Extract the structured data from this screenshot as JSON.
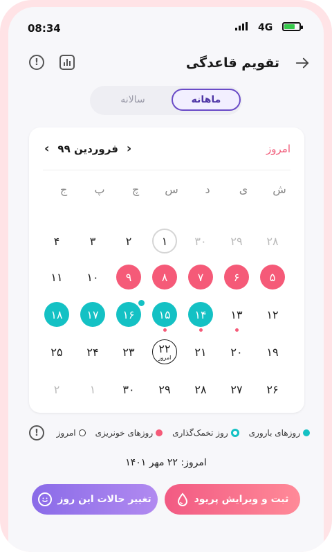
{
  "status_bar": {
    "time": "08:34",
    "network": "4G"
  },
  "header": {
    "title": "تقویم قاعدگی"
  },
  "tabs": {
    "monthly": "ماهانه",
    "yearly": "سالانه",
    "selected": "monthly"
  },
  "calendar": {
    "today_link": "امروز",
    "month_label": "فروردین ۹۹",
    "weekdays": [
      "ش",
      "ی",
      "د",
      "س",
      "چ",
      "پ",
      "ج"
    ],
    "weeks": [
      [
        "۲۸",
        "۲۹",
        "۳۰",
        "۱",
        "۲",
        "۳",
        "۴"
      ],
      [
        "۵",
        "۶",
        "۷",
        "۸",
        "۹",
        "۱۰",
        "۱۱"
      ],
      [
        "۱۲",
        "۱۳",
        "۱۴",
        "۱۵",
        "۱۶",
        "۱۷",
        "۱۸"
      ],
      [
        "۱۹",
        "۲۰",
        "۲۱",
        "۲۲",
        "۲۳",
        "۲۴",
        "۲۵"
      ],
      [
        "۲۶",
        "۲۷",
        "۲۸",
        "۲۹",
        "۳۰",
        "۱",
        "۲"
      ]
    ],
    "today_small_label": "امروز"
  },
  "legend": {
    "fertile": "روزهای باروری",
    "ovulation": "روز تخمک‌گذاری",
    "period": "روزهای خونریزی",
    "today": "امروز"
  },
  "today_text": "امروز: ۲۲ مهر ۱۴۰۱",
  "buttons": {
    "period": "ثبت و ویرایش پریود",
    "mood": "تغییر حالات این روز"
  },
  "colors": {
    "period": "#f55a78",
    "fertile": "#14c1c4",
    "accent": "#6a4bc7"
  },
  "icons": [
    "info-icon",
    "stats-icon",
    "back-arrow-icon",
    "chevron-left-icon",
    "chevron-right-icon",
    "drop-icon",
    "smile-icon"
  ]
}
